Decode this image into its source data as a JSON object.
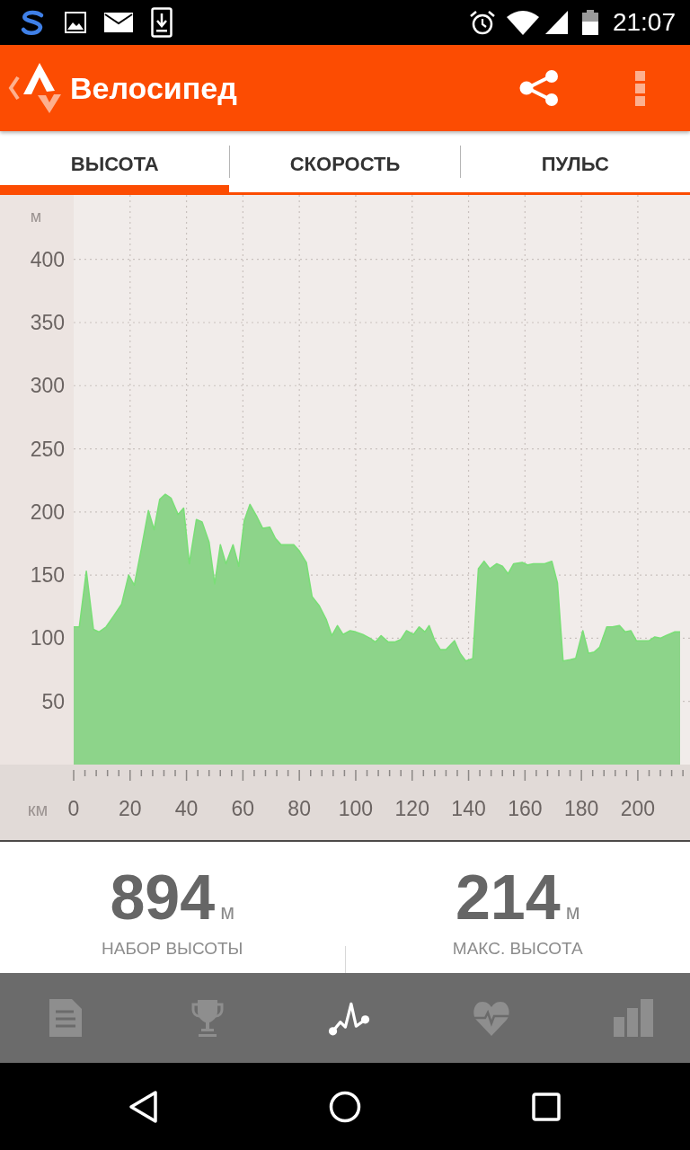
{
  "status_bar": {
    "time": "21:07"
  },
  "app_bar": {
    "title": "Велосипед"
  },
  "tabs": [
    {
      "label": "ВЫСОТА",
      "selected": true
    },
    {
      "label": "СКОРОСТЬ",
      "selected": false
    },
    {
      "label": "ПУЛЬС",
      "selected": false
    }
  ],
  "chart": {
    "chart_data": {
      "type": "area",
      "xlabel": "км",
      "ylabel": "м",
      "x": [
        0,
        2,
        4.5,
        7,
        9,
        11.5,
        14,
        17,
        19.5,
        21.5,
        24,
        26.5,
        28.5,
        30.5,
        32.5,
        34.5,
        37,
        39,
        41,
        43.5,
        45.5,
        48,
        50,
        52,
        54,
        56.5,
        58.5,
        60.5,
        62.5,
        65,
        67,
        69.5,
        71.5,
        73.5,
        76,
        78,
        80,
        82.5,
        84.5,
        87,
        89.5,
        91.5,
        93.5,
        95.5,
        98,
        100,
        102.5,
        105,
        107,
        109,
        111.5,
        114,
        116,
        118,
        120.5,
        122.5,
        124.5,
        126,
        128,
        130,
        132,
        135,
        137,
        139,
        141.5,
        143.5,
        145.5,
        147.5,
        150,
        152,
        154,
        156,
        159,
        161,
        163,
        165,
        167,
        169.5,
        171.5,
        173.5,
        176,
        178,
        180.5,
        182.5,
        184.5,
        186.5,
        189,
        191,
        193.5,
        195.5,
        197.5,
        199.5,
        202,
        204,
        206,
        208,
        210,
        213,
        215
      ],
      "series": [
        {
          "color": "#8dd48a",
          "values": [
            109,
            109,
            153,
            107,
            105,
            109,
            117,
            127,
            150,
            142,
            171,
            201,
            186,
            210,
            214,
            211,
            198,
            203,
            159,
            194,
            192,
            176,
            143,
            174,
            159,
            174,
            157,
            193,
            206,
            196,
            187,
            188,
            179,
            174,
            174,
            174,
            169,
            160,
            133,
            126,
            115,
            102,
            110,
            103,
            106,
            105,
            103,
            100,
            97,
            102,
            97,
            97,
            99,
            106,
            103,
            109,
            105,
            110,
            98,
            91,
            91,
            98,
            88,
            82,
            84,
            155,
            161,
            155,
            159,
            157,
            151,
            159,
            160,
            158,
            159,
            159,
            159,
            161,
            144,
            82,
            83,
            84,
            106,
            88,
            89,
            93,
            109,
            109,
            110,
            105,
            106,
            98,
            98,
            98,
            101,
            100,
            102,
            105,
            105
          ]
        }
      ],
      "xlim": [
        0,
        218.5
      ],
      "ylim": [
        0,
        451
      ],
      "xticks": [
        0,
        20,
        40,
        60,
        80,
        100,
        120,
        140,
        160,
        180,
        200
      ],
      "yticks": [
        50,
        100,
        150,
        200,
        250,
        300,
        350,
        400
      ],
      "grid": true
    }
  },
  "stats": [
    {
      "value": "894",
      "unit": "м",
      "label": "НАБОР ВЫСОТЫ"
    },
    {
      "value": "214",
      "unit": "м",
      "label": "МАКС. ВЫСОТА"
    }
  ],
  "bottom_nav": [
    {
      "selected": false
    },
    {
      "selected": false
    },
    {
      "selected": true
    },
    {
      "selected": false
    },
    {
      "selected": false
    }
  ]
}
